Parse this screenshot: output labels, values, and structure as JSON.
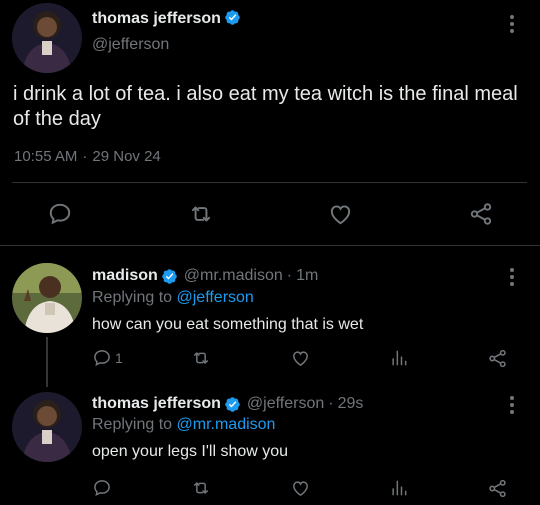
{
  "main_tweet": {
    "author_name": "thomas jefferson",
    "handle": "@jefferson",
    "text": "i drink a lot of tea. i also eat my tea witch is the final meal of the day",
    "time": "10:55 AM",
    "separator": "·",
    "date": "29 Nov 24"
  },
  "replies": [
    {
      "author_name": "madison",
      "handle": "@mr.madison",
      "separator": "·",
      "age": "1m",
      "replying_prefix": "Replying to",
      "replying_to": "@jefferson",
      "text": "how can you eat something that is wet",
      "reply_count": "1"
    },
    {
      "author_name": "thomas jefferson",
      "handle": "@jefferson",
      "separator": "·",
      "age": "29s",
      "replying_prefix": "Replying to",
      "replying_to": "@mr.madison",
      "text": "open your legs I'll show you"
    }
  ],
  "colors": {
    "background": "#000000",
    "text": "#e7e9ea",
    "muted": "#71767b",
    "accent": "#1d9bf0",
    "divider": "#2f3336"
  },
  "icons": [
    "verified-badge-icon",
    "more-options-icon",
    "reply-icon",
    "retweet-icon",
    "like-icon",
    "share-icon",
    "views-icon"
  ]
}
